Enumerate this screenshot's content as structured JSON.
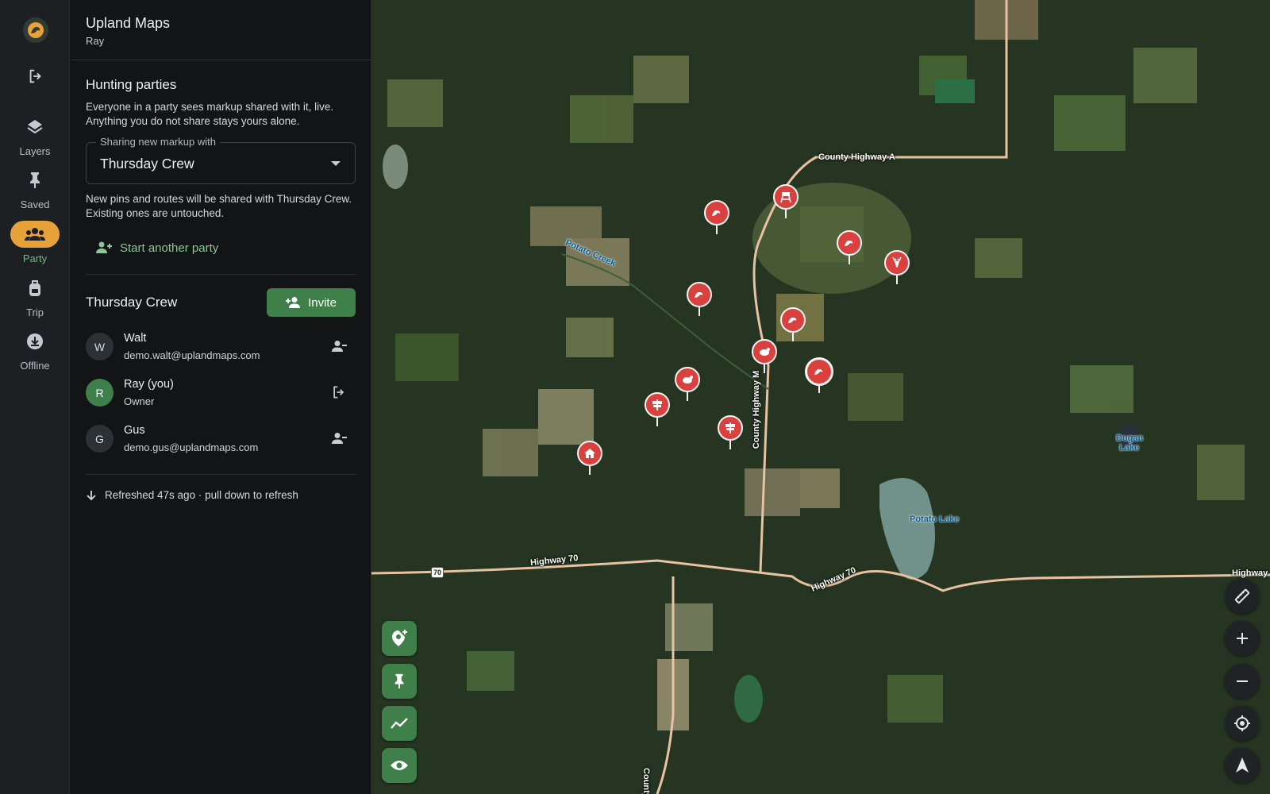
{
  "app": {
    "title": "Upland Maps",
    "user": "Ray"
  },
  "rail": {
    "items": [
      {
        "label": "Layers",
        "icon": "layers-icon"
      },
      {
        "label": "Saved",
        "icon": "pin-icon"
      },
      {
        "label": "Party",
        "icon": "group-icon",
        "active": true
      },
      {
        "label": "Trip",
        "icon": "backpack-icon"
      },
      {
        "label": "Offline",
        "icon": "download-icon"
      }
    ]
  },
  "party": {
    "heading": "Hunting parties",
    "description": "Everyone in a party sees markup shared with it, live. Anything you do not share stays yours alone.",
    "share_label": "Sharing new markup with",
    "share_value": "Thursday Crew",
    "share_note": "New pins and routes will be shared with Thursday Crew. Existing ones are untouched.",
    "start_another": "Start another party",
    "crew_name": "Thursday Crew",
    "invite_label": "Invite",
    "members": [
      {
        "initial": "W",
        "name": "Walt",
        "sub": "demo.walt@uplandmaps.com",
        "action": "remove-member-icon"
      },
      {
        "initial": "R",
        "name": "Ray (you)",
        "sub": "Owner",
        "action": "leave-party-icon"
      },
      {
        "initial": "G",
        "name": "Gus",
        "sub": "demo.gus@uplandmaps.com",
        "action": "remove-member-icon"
      }
    ],
    "refresh_text": "Refreshed 47s ago · pull down to refresh"
  },
  "map": {
    "labels": {
      "county_a": "County Highway A",
      "potato_creek": "Potato Creek",
      "county_m": "County Highway M",
      "highway70_w": "Highway 70",
      "highway70_e": "Highway 70",
      "highway_far": "Highway",
      "county_bottom": "County",
      "potato_lake": "Potato Lake",
      "dugan_lake_1": "Dugan",
      "dugan_lake_2": "Lake",
      "route_shield": "70"
    },
    "pins": [
      {
        "icon": "bird-icon"
      },
      {
        "icon": "stand-icon"
      },
      {
        "icon": "bird-icon"
      },
      {
        "icon": "deer-icon"
      },
      {
        "icon": "bird-icon"
      },
      {
        "icon": "bird-icon"
      },
      {
        "icon": "turkey-icon"
      },
      {
        "icon": "bird-icon"
      },
      {
        "icon": "turkey-icon"
      },
      {
        "icon": "sign-icon"
      },
      {
        "icon": "sign-icon"
      },
      {
        "icon": "cabin-icon"
      }
    ],
    "accent_pin": "#d9413f",
    "accent_green": "#3f7f4a"
  }
}
